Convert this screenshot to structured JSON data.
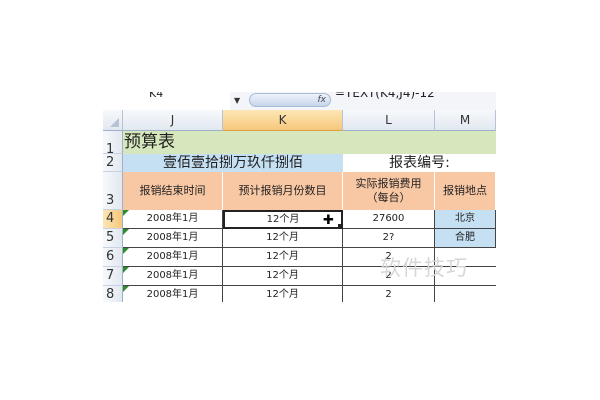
{
  "formula_bar": {
    "name_box": "K4",
    "fx_label": "fx",
    "formula": "=TEXT(K4,J4)-12"
  },
  "columns": [
    "J",
    "K",
    "L",
    "M"
  ],
  "rows": [
    "1",
    "2",
    "3",
    "4",
    "5",
    "6",
    "7",
    "8"
  ],
  "sheet": {
    "title": "预算表",
    "amount_text": "壹佰壹拾捌万玖仟捌佰",
    "report_no_label": "报表编号:",
    "headers": [
      "报销结束时间",
      "预计报销月份数目",
      [
        "实际报销费用",
        "（每台）"
      ],
      "报销地点"
    ],
    "data_rows": [
      [
        "2008年1月",
        "12个月",
        "27600",
        "北京"
      ],
      [
        "2008年1月",
        "12个月",
        "2?",
        "合肥"
      ],
      [
        "2008年1月",
        "12个月",
        "2",
        ""
      ],
      [
        "2008年1月",
        "12个月",
        "2",
        ""
      ],
      [
        "2008年1月",
        "12个月",
        "2",
        ""
      ]
    ]
  },
  "colors": {
    "title_bg": "#d6e6bd",
    "amount_bg": "#c5dff3",
    "header_bg": "#f8c7a4",
    "selected_header": "#f6c77c"
  },
  "watermark": "软件技巧"
}
